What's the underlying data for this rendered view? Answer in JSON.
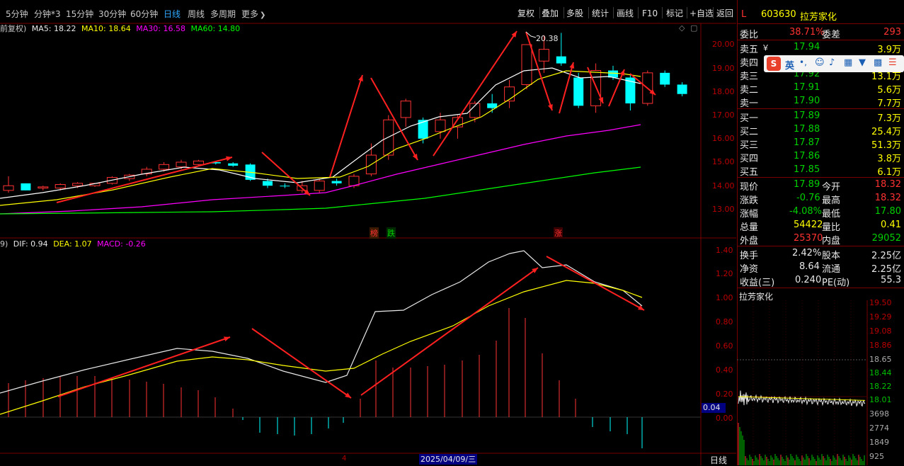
{
  "toolbar": {
    "periods": [
      "5分钟",
      "分钟*3",
      "15分钟",
      "30分钟",
      "60分钟",
      "日线",
      "周线",
      "多周期",
      "更多"
    ],
    "more_arrow": "❯",
    "buttons": [
      "复权",
      "叠加",
      "多股",
      "统计",
      "画线",
      "F10",
      "标记",
      "+自选",
      "返回"
    ]
  },
  "main_chart": {
    "adjust_label": "前复权)",
    "ma5": "MA5: 18.22",
    "ma10": "MA10: 18.64",
    "ma30": "MA30: 16.58",
    "ma60": "MA60: 14.80",
    "price_axis": [
      "20.00",
      "19.00",
      "18.00",
      "17.00",
      "16.00",
      "15.00",
      "14.00",
      "13.00"
    ],
    "high_marker": "20.38",
    "badges": [
      "榜",
      "跌",
      "涨"
    ]
  },
  "macd": {
    "label_prefix": "9)",
    "dif": "DIF: 0.94",
    "dea": "DEA: 1.07",
    "macd": "MACD: -0.26",
    "axis": [
      "1.40",
      "1.20",
      "1.00",
      "0.80",
      "0.60",
      "0.40",
      "0.20",
      "0.00"
    ],
    "cursor_value": "0.04",
    "bottom_marker": "4",
    "date_tag": "2025/04/09/三",
    "period_tag": "日线"
  },
  "quote": {
    "indicator": "L",
    "code": "603630",
    "name": "拉芳家化",
    "webi": {
      "label": "委比",
      "value": "38.71%",
      "label2": "委差",
      "value2": "293"
    },
    "asks": [
      {
        "label": "卖五",
        "extra": "￥",
        "price": "17.94",
        "vol": "3.9万"
      },
      {
        "label": "卖四",
        "price": "",
        "vol": ""
      },
      {
        "label": "卖三",
        "price": "17.92",
        "vol": "13.1万"
      },
      {
        "label": "卖二",
        "price": "17.91",
        "vol": "5.6万"
      },
      {
        "label": "卖一",
        "price": "17.90",
        "vol": "7.7万"
      }
    ],
    "bids": [
      {
        "label": "买一",
        "price": "17.89",
        "vol": "7.3万"
      },
      {
        "label": "买二",
        "price": "17.88",
        "vol": "25.4万"
      },
      {
        "label": "买三",
        "price": "17.87",
        "vol": "51.3万"
      },
      {
        "label": "买四",
        "price": "17.86",
        "vol": "3.8万"
      },
      {
        "label": "买五",
        "price": "17.85",
        "vol": "6.1万"
      }
    ],
    "stats": [
      {
        "l1": "现价",
        "v1": "17.89",
        "l2": "今开",
        "v2": "18.32"
      },
      {
        "l1": "涨跌",
        "v1": "-0.76",
        "l2": "最高",
        "v2": "18.32"
      },
      {
        "l1": "涨幅",
        "v1": "-4.08%",
        "l2": "最低",
        "v2": "17.80"
      },
      {
        "l1": "总量",
        "v1": "54422",
        "l2": "量比",
        "v2": "0.41"
      },
      {
        "l1": "外盘",
        "v1": "25370",
        "l2": "内盘",
        "v2": "29052"
      }
    ],
    "fin": [
      {
        "l1": "换手",
        "v1": "2.42%",
        "l2": "股本",
        "v2": "2.25亿"
      },
      {
        "l1": "净资",
        "v1": "8.64",
        "l2": "流通",
        "v2": "2.25亿"
      },
      {
        "l1": "收益(三)",
        "v1": "0.240",
        "l2": "PE(动)",
        "v2": "55.3"
      }
    ],
    "mini_title": "拉芳家化",
    "mini_price_axis": [
      "19.50",
      "19.29",
      "19.08",
      "18.86",
      "18.65",
      "18.44",
      "18.22",
      "18.01"
    ],
    "mini_vol_axis": [
      "3698",
      "2774",
      "1849",
      "925"
    ],
    "ime": {
      "logo": "S",
      "lang": "英",
      "punct": "•,"
    }
  },
  "colors": {
    "up": "#ff3232",
    "down": "#00ffff",
    "ma5": "#ffffff",
    "ma10": "#ffff00",
    "ma30": "#ff00ff",
    "ma60": "#00ff00"
  }
}
